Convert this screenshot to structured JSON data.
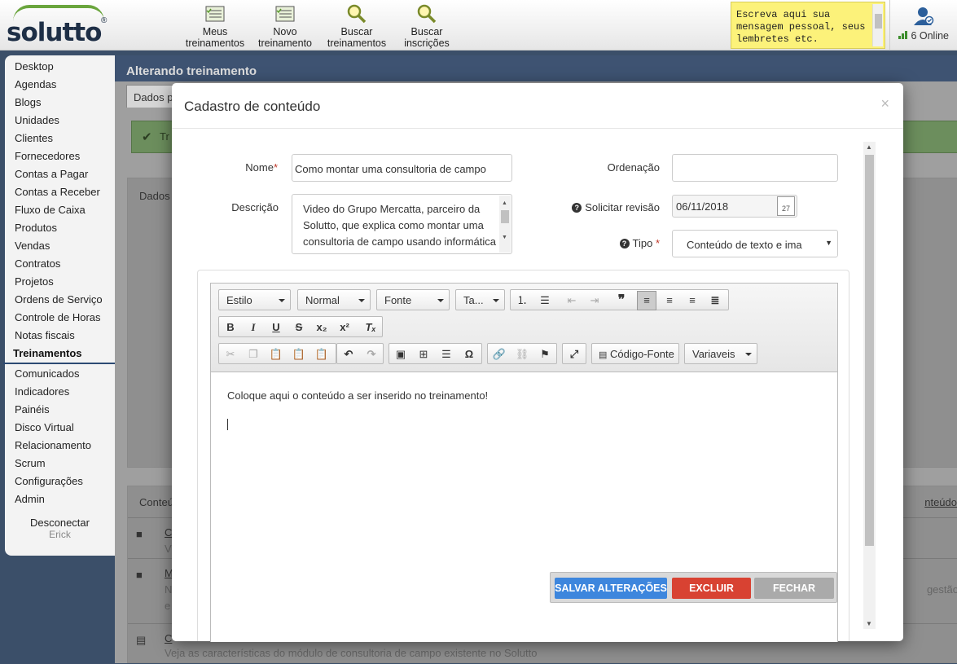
{
  "topbar": {
    "logo_text": "solutto",
    "buttons": [
      {
        "line1": "Meus",
        "line2": "treinamentos",
        "icon": "list-icon"
      },
      {
        "line1": "Novo",
        "line2": "treinamento",
        "icon": "list-icon"
      },
      {
        "line1": "Buscar",
        "line2": "treinamentos",
        "icon": "search-icon"
      },
      {
        "line1": "Buscar",
        "line2": "inscrições",
        "icon": "search-icon"
      }
    ],
    "memo": "Escreva aqui sua mensagem pessoal, seus lembretes etc.",
    "online": "6 Online"
  },
  "sidebar": {
    "items": [
      "Desktop",
      "Agendas",
      "Blogs",
      "Unidades",
      "Clientes",
      "Fornecedores",
      "Contas a Pagar",
      "Contas a Receber",
      "Fluxo de Caixa",
      "Produtos",
      "Vendas",
      "Contratos",
      "Projetos",
      "Ordens de Serviço",
      "Controle de Horas",
      "Notas fiscais"
    ],
    "active": "Treinamentos",
    "items2": [
      "Comunicados",
      "Indicadores",
      "Painéis",
      "Disco Virtual",
      "Relacionamento",
      "Scrum",
      "Configurações",
      "Admin"
    ],
    "logout": "Desconectar",
    "user": "Erick"
  },
  "page": {
    "header": "Alterando treinamento",
    "tab": "Dados p",
    "success": "Tr",
    "panel_title": "Dados",
    "list_title": "Conteú",
    "list_link": "nteúdo",
    "rows": [
      {
        "t": "C",
        "d": "V"
      },
      {
        "t": "M",
        "d": "N",
        "d2": "e",
        "tail": "gestão"
      },
      {
        "t": "C",
        "d": "Veja as características do módulo de consultoria de campo existente no Solutto"
      }
    ]
  },
  "modal": {
    "title": "Cadastro de conteúdo",
    "close": "×",
    "nome_label": "Nome",
    "nome_value": "Como montar uma consultoria de campo",
    "descricao_label": "Descrição",
    "descricao_value": "Video do Grupo Mercatta, parceiro da Solutto, que explica como montar uma consultoria de campo usando informática",
    "ordenacao_label": "Ordenação",
    "ordenacao_value": "",
    "revisao_label": "Solicitar revisão",
    "revisao_value": "06/11/2018",
    "calendar_day": "27",
    "tipo_label": "Tipo",
    "tipo_value": "Conteúdo de texto e ima",
    "editor": {
      "combos": {
        "estilo": "Estilo",
        "normal": "Normal",
        "fonte": "Fonte",
        "tamanho": "Ta...",
        "variaveis": "Variaveis"
      },
      "source": "Código-Fonte",
      "content": "Coloque aqui o conteúdo a ser inserido no treinamento!"
    },
    "buttons": {
      "save": "SALVAR ALTERAÇÕES",
      "delete": "EXCLUIR",
      "close": "FECHAR"
    },
    "colors": {
      "save": "#3d86dd",
      "delete": "#d84232",
      "close": "#aaaaaa"
    }
  }
}
